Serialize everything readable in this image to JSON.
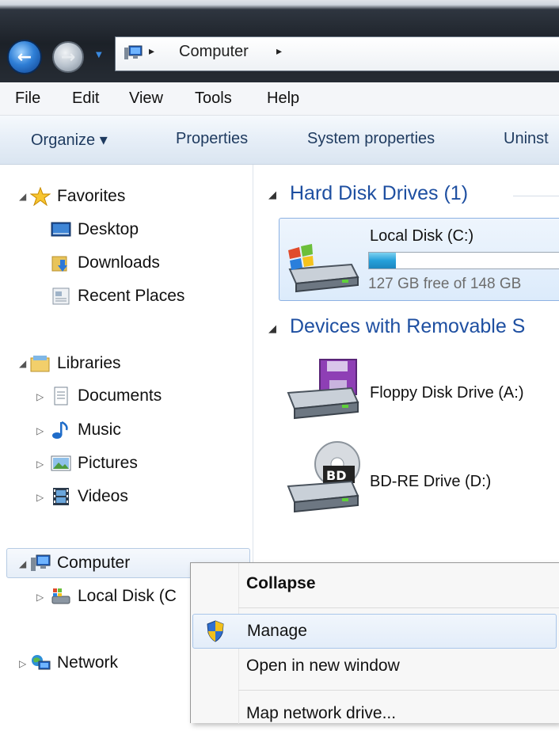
{
  "address_bar": {
    "location": "Computer",
    "separator": "▸"
  },
  "menu_bar": [
    "File",
    "Edit",
    "View",
    "Tools",
    "Help"
  ],
  "command_bar": [
    "Organize ▾",
    "Properties",
    "System properties",
    "Uninst"
  ],
  "nav_pane": {
    "favorites": {
      "label": "Favorites",
      "items": [
        "Desktop",
        "Downloads",
        "Recent Places"
      ]
    },
    "libraries": {
      "label": "Libraries",
      "items": [
        "Documents",
        "Music",
        "Pictures",
        "Videos"
      ]
    },
    "computer": {
      "label": "Computer",
      "items": [
        "Local Disk (C"
      ]
    },
    "network": {
      "label": "Network"
    }
  },
  "content": {
    "hard_disk_group": "Hard Disk Drives (1)",
    "local_disk": {
      "name": "Local Disk (C:)",
      "space": "127 GB free of 148 GB",
      "used_fraction": 0.14
    },
    "removable_group": "Devices with Removable S",
    "floppy": "Floppy Disk Drive (A:)",
    "bd": {
      "name": "BD-RE Drive (D:)",
      "badge": "BD"
    }
  },
  "context_menu": {
    "collapse": "Collapse",
    "manage": "Manage",
    "open_new_window": "Open in new window",
    "map_network_drive": "Map network drive..."
  },
  "colors": {
    "group_header": "#1e4fa1",
    "capacity_fill": "#26a0da",
    "selection_border": "#8db2e3"
  }
}
